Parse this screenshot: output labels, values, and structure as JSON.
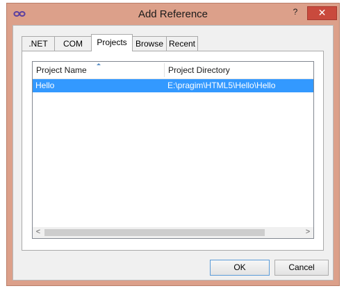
{
  "window": {
    "title": "Add Reference",
    "help_label": "?",
    "close_label": "✕"
  },
  "tabs": [
    {
      "label": ".NET",
      "active": false
    },
    {
      "label": "COM",
      "active": false
    },
    {
      "label": "Projects",
      "active": true
    },
    {
      "label": "Browse",
      "active": false
    },
    {
      "label": "Recent",
      "active": false
    }
  ],
  "list": {
    "columns": [
      "Project Name",
      "Project Directory"
    ],
    "rows": [
      {
        "project_name": "Hello",
        "project_directory": "E:\\pragim\\HTML5\\Hello\\Hello",
        "selected": true
      }
    ]
  },
  "scrollbar": {
    "left_arrow": "<",
    "right_arrow": ">"
  },
  "buttons": {
    "ok_label": "OK",
    "cancel_label": "Cancel"
  },
  "colors": {
    "frame": "#dca08a",
    "close_button": "#c94a3d",
    "selection": "#3399ff"
  }
}
